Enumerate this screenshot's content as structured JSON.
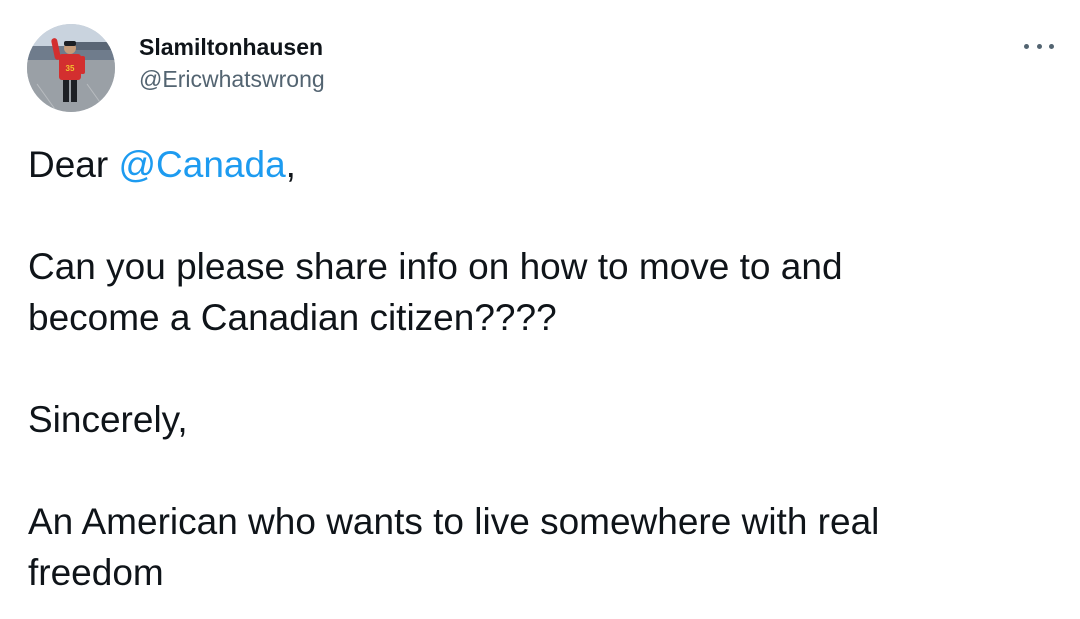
{
  "tweet": {
    "display_name": "Slamiltonhausen",
    "handle": "@Ericwhatswrong",
    "more_icon": "more-dots-icon",
    "mention_color": "#1d9bf0",
    "text": {
      "line1_prefix": "Dear ",
      "mention": "@Canada",
      "line1_suffix": ",",
      "paragraph2": "Can you please share info on how to move to and become a Canadian citizen????",
      "paragraph3": "Sincerely,",
      "paragraph4": "An American who wants to live somewhere with real freedom"
    },
    "avatar": {
      "jersey_number": "35"
    }
  }
}
